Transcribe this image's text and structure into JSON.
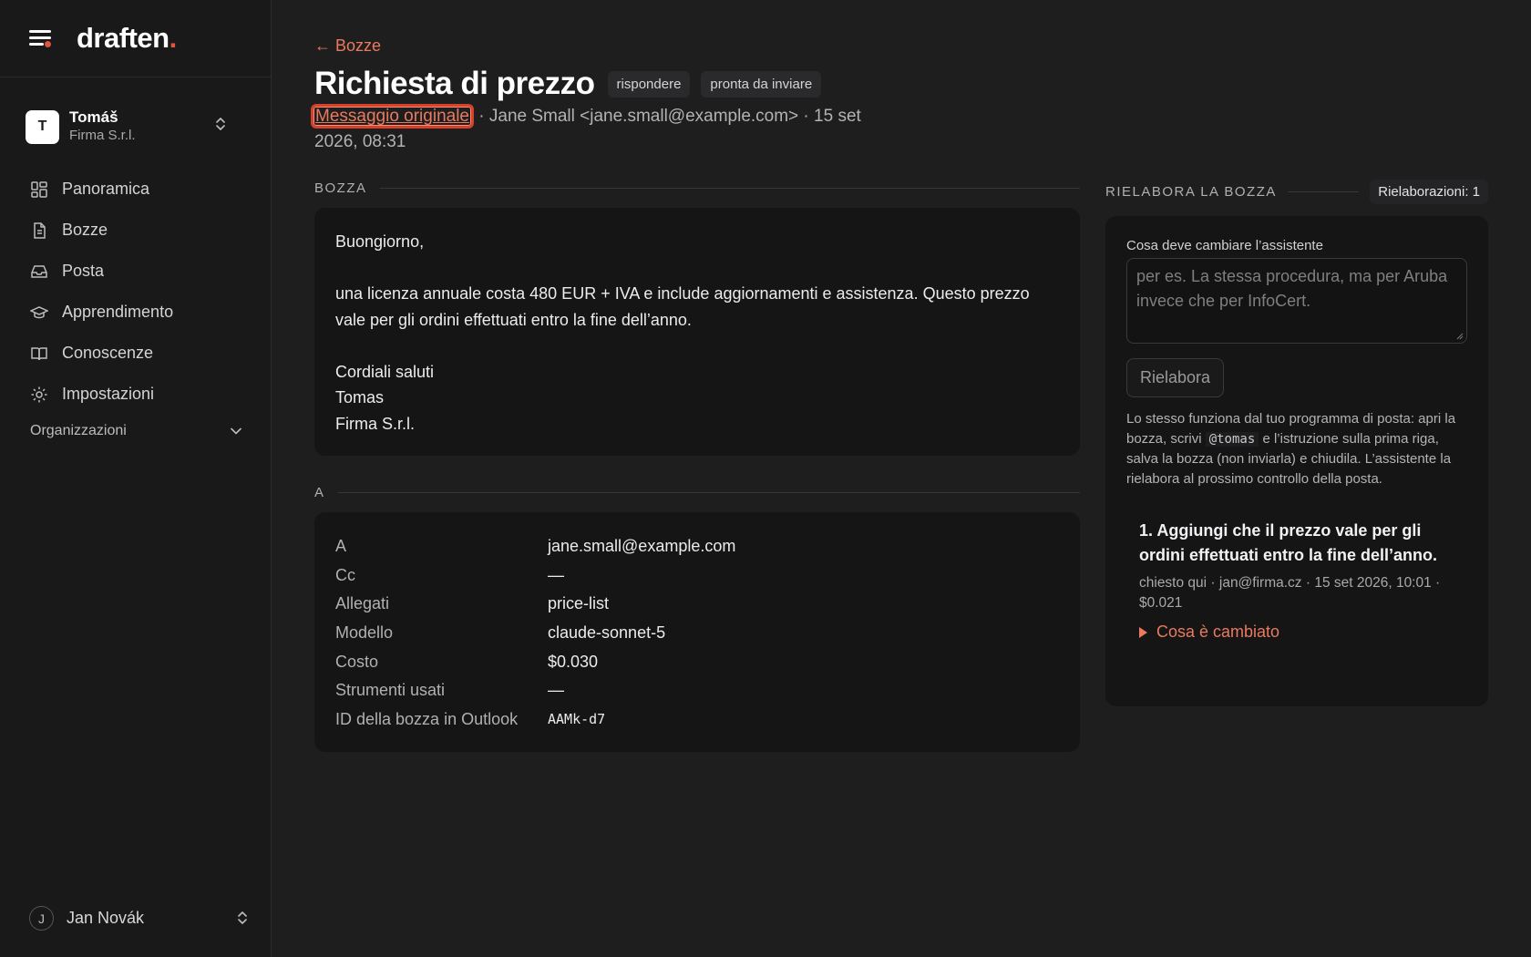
{
  "app": {
    "logo_text": "draften",
    "logo_dot": ".",
    "accent_color": "#e97a5f"
  },
  "account": {
    "initial": "T",
    "name": "Tomáš",
    "company": "Firma S.r.l."
  },
  "sidebar": {
    "items": [
      {
        "label": "Panoramica",
        "icon": "dashboard-icon"
      },
      {
        "label": "Bozze",
        "icon": "document-icon"
      },
      {
        "label": "Posta",
        "icon": "inbox-icon"
      },
      {
        "label": "Apprendimento",
        "icon": "graduation-cap-icon"
      },
      {
        "label": "Conoscenze",
        "icon": "book-icon"
      },
      {
        "label": "Impostazioni",
        "icon": "gear-icon"
      }
    ],
    "org_label": "Organizzazioni"
  },
  "user": {
    "initial": "J",
    "name": "Jan Novák"
  },
  "header": {
    "back_label": "← Bozze",
    "title": "Richiesta di prezzo",
    "tags": [
      "rispondere",
      "pronta da inviare"
    ],
    "original_link": "Messaggio originale",
    "meta_rest": " · Jane Small <jane.small@example.com> · 15 set 2026, 08:31"
  },
  "draft": {
    "section_label": "BOZZA",
    "body": "Buongiorno,\n\nuna licenza annuale costa 480 EUR + IVA e include aggiornamenti e assistenza. Questo prezzo vale per gli ordini effettuati entro la fine dell’anno.\n\nCordiali saluti\nTomas\nFirma S.r.l."
  },
  "details": {
    "section_label": "A",
    "rows": [
      {
        "key": "A",
        "value": "jane.small@example.com"
      },
      {
        "key": "Cc",
        "value": "—"
      },
      {
        "key": "Allegati",
        "value": "price-list"
      },
      {
        "key": "Modello",
        "value": "claude-sonnet-5"
      },
      {
        "key": "Costo",
        "value": "$0.030"
      },
      {
        "key": "Strumenti usati",
        "value": "—"
      },
      {
        "key": "ID della bozza in Outlook",
        "value": "AAMk-d7"
      }
    ]
  },
  "rework": {
    "section_label": "RIELABORA LA BOZZA",
    "count_badge": "Rielaborazioni: 1",
    "field_label": "Cosa deve cambiare l’assistente",
    "placeholder": "per es. La stessa procedura, ma per Aruba invece che per InfoCert.",
    "button_label": "Rielabora",
    "help_part1": "Lo stesso funziona dal tuo programma di posta: apri la bozza, scrivi ",
    "help_code": "@tomas",
    "help_part2": " e l’istruzione sulla prima riga, salva la bozza (non inviarla) e chiudila. L’assistente la rielabora al prossimo controllo della posta.",
    "request": {
      "text": "1. Aggiungi che il prezzo vale per gli ordini effettuati entro la fine dell’anno.",
      "meta": "chiesto qui · jan@firma.cz · 15 set 2026, 10:01 · $0.021",
      "changes_link": "Cosa è cambiato"
    }
  }
}
